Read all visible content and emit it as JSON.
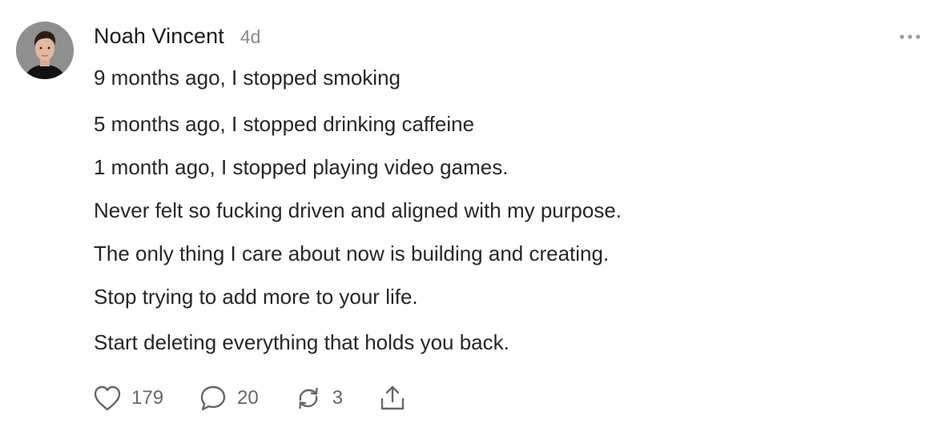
{
  "post": {
    "author": "Noah Vincent",
    "timestamp": "4d",
    "lines": [
      "9 months ago, I stopped smoking",
      "5 months ago, I stopped drinking caffeine",
      "1 month ago, I stopped playing video games.",
      "Never felt so fucking driven and aligned with my purpose.",
      "The only thing I care about now is building and creating.",
      "Stop trying to add more to your life.",
      "Start deleting everything that holds you back."
    ]
  },
  "actions": {
    "likes": "179",
    "replies": "20",
    "reposts": "3"
  },
  "icons": {
    "more": "more-horizontal-icon",
    "like": "heart-icon",
    "reply": "comment-bubble-icon",
    "repost": "repost-icon",
    "share": "share-icon"
  },
  "colors": {
    "text": "#262626",
    "muted": "#8a8a8a",
    "icon": "#666666"
  }
}
